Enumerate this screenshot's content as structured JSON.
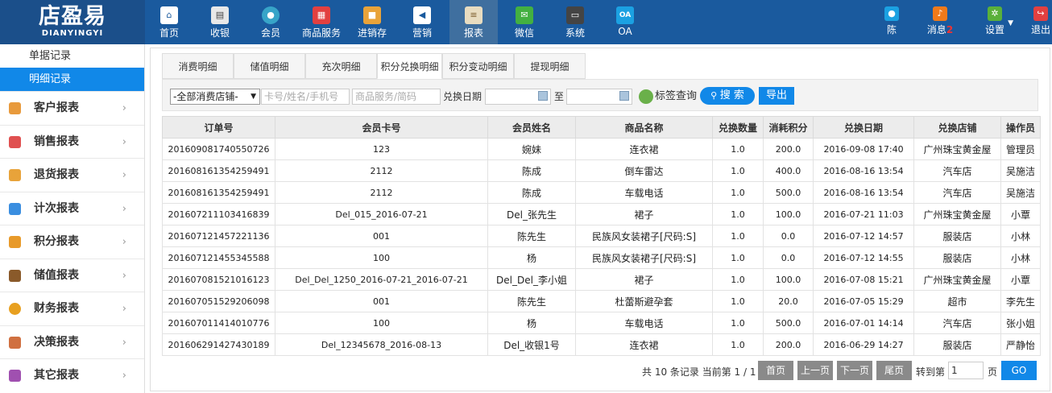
{
  "app": {
    "logo_cn": "店盈易",
    "logo_en": "DIANYINGYI"
  },
  "nav": [
    {
      "label": "首页",
      "icon": "home-icon",
      "color": "#ffffff"
    },
    {
      "label": "收银",
      "icon": "cash-register-icon",
      "color": "#e8e8e8"
    },
    {
      "label": "会员",
      "icon": "member-icon",
      "color": "#37a4c8"
    },
    {
      "label": "商品服务",
      "icon": "gift-icon",
      "color": "#e24040"
    },
    {
      "label": "进销存",
      "icon": "box-icon",
      "color": "#e8a33a"
    },
    {
      "label": "营销",
      "icon": "megaphone-icon",
      "color": "#ffffff"
    },
    {
      "label": "报表",
      "icon": "report-icon",
      "color": "#e8dcc0"
    },
    {
      "label": "微信",
      "icon": "wechat-icon",
      "color": "#43b041"
    },
    {
      "label": "系统",
      "icon": "monitor-icon",
      "color": "#444444"
    },
    {
      "label": "OA",
      "icon": "oa-icon",
      "color": "#1ba1e2"
    }
  ],
  "user": {
    "name": "陈",
    "messages_label": "消息",
    "messages_count": "2",
    "settings_label": "设置",
    "logout_label": "退出"
  },
  "sidebar": {
    "sub": [
      "单据记录",
      "明细记录"
    ],
    "items": [
      {
        "label": "客户报表",
        "icon": "customer-icon",
        "color": "#e89a3c"
      },
      {
        "label": "销售报表",
        "icon": "sales-icon",
        "color": "#e05050"
      },
      {
        "label": "退货报表",
        "icon": "return-icon",
        "color": "#e8a33a"
      },
      {
        "label": "计次报表",
        "icon": "bar-chart-icon",
        "color": "#3a8ee0"
      },
      {
        "label": "积分报表",
        "icon": "tag-icon",
        "color": "#e89a2a"
      },
      {
        "label": "储值报表",
        "icon": "wallet-icon",
        "color": "#8a5a2a"
      },
      {
        "label": "财务报表",
        "icon": "coin-icon",
        "color": "#e8a020"
      },
      {
        "label": "决策报表",
        "icon": "decision-icon",
        "color": "#d07040"
      },
      {
        "label": "其它报表",
        "icon": "folder-icon",
        "color": "#a050b0"
      }
    ]
  },
  "tabs": [
    "消费明细",
    "储值明细",
    "充次明细",
    "积分兑换明细",
    "积分变动明细",
    "提现明细"
  ],
  "filter": {
    "store_select": "-全部消费店铺-",
    "card_placeholder": "卡号/姓名/手机号",
    "goods_placeholder": "商品服务/简码",
    "date_label": "兑换日期",
    "to_label": "至",
    "tag_query": "标签查询",
    "search_btn": "搜 索",
    "export_btn": "导出"
  },
  "table": {
    "headers": [
      "订单号",
      "会员卡号",
      "会员姓名",
      "商品名称",
      "兑换数量",
      "消耗积分",
      "兑换日期",
      "兑换店铺",
      "操作员"
    ],
    "rows": [
      [
        "201609081740550726",
        "123",
        "婉妹",
        "连衣裙",
        "1.0",
        "200.0",
        "2016-09-08 17:40",
        "广州珠宝黄金屋",
        "管理员"
      ],
      [
        "201608161354259491",
        "2112",
        "陈成",
        "倒车雷达",
        "1.0",
        "400.0",
        "2016-08-16 13:54",
        "汽车店",
        "吴施洁"
      ],
      [
        "201608161354259491",
        "2112",
        "陈成",
        "车载电话",
        "1.0",
        "500.0",
        "2016-08-16 13:54",
        "汽车店",
        "吴施洁"
      ],
      [
        "201607211103416839",
        "Del_015_2016-07-21",
        "Del_张先生",
        "裙子",
        "1.0",
        "100.0",
        "2016-07-21 11:03",
        "广州珠宝黄金屋",
        "小覃"
      ],
      [
        "201607121457221136",
        "001",
        "陈先生",
        "民族风女装裙子[尺码:S]",
        "1.0",
        "0.0",
        "2016-07-12 14:57",
        "服装店",
        "小林"
      ],
      [
        "201607121455345588",
        "100",
        "杨",
        "民族风女装裙子[尺码:S]",
        "1.0",
        "0.0",
        "2016-07-12 14:55",
        "服装店",
        "小林"
      ],
      [
        "201607081521016123",
        "Del_Del_1250_2016-07-21_2016-07-21",
        "Del_Del_李小姐",
        "裙子",
        "1.0",
        "100.0",
        "2016-07-08 15:21",
        "广州珠宝黄金屋",
        "小覃"
      ],
      [
        "201607051529206098",
        "001",
        "陈先生",
        "杜蕾斯避孕套",
        "1.0",
        "20.0",
        "2016-07-05 15:29",
        "超市",
        "李先生"
      ],
      [
        "201607011414010776",
        "100",
        "杨",
        "车载电话",
        "1.0",
        "500.0",
        "2016-07-01 14:14",
        "汽车店",
        "张小姐"
      ],
      [
        "201606291427430189",
        "Del_12345678_2016-08-13",
        "Del_收银1号",
        "连衣裙",
        "1.0",
        "200.0",
        "2016-06-29 14:27",
        "服装店",
        "严静怡"
      ]
    ]
  },
  "pager": {
    "summary": "共 10 条记录 当前第 1 / 1",
    "first": "首页",
    "prev": "上一页",
    "next": "下一页",
    "last": "尾页",
    "goto_label": "转到第",
    "goto_value": "1",
    "page_unit": "页",
    "go": "GO"
  }
}
